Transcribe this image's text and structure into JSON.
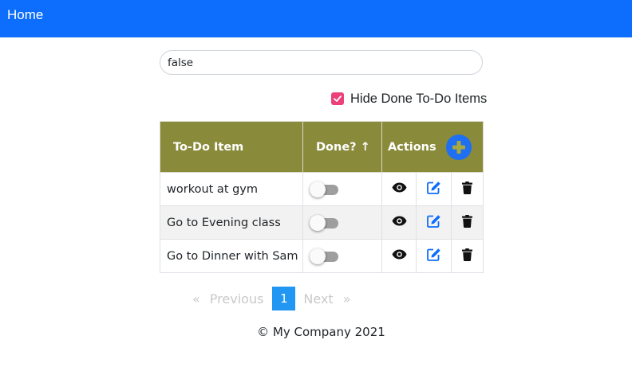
{
  "navbar": {
    "home_label": "Home",
    "color": "#0d6efd"
  },
  "search": {
    "value": "false",
    "placeholder": ""
  },
  "filter": {
    "hide_done_label": "Hide Done To-Do Items",
    "hide_done_checked": true,
    "checkbox_color": "#ec407a"
  },
  "table": {
    "header_color": "#898a3a",
    "columns": {
      "item": "To-Do Item",
      "done": "Done? ↑",
      "actions": "Actions"
    },
    "add_button": {
      "icon": "plus-circle-icon",
      "color": "#1e6ff1",
      "plus_color": "#a7a83f"
    },
    "action_icons": {
      "view": "eye-icon",
      "edit": "edit-icon",
      "delete": "trash-icon",
      "edit_color": "#0d6efd"
    },
    "rows": [
      {
        "item": "workout at gym",
        "done": false
      },
      {
        "item": "Go to Evening class",
        "done": false
      },
      {
        "item": "Go to Dinner with Sam",
        "done": false
      }
    ]
  },
  "pagination": {
    "prev_arrow": "«",
    "prev_label": "Previous",
    "current_page": "1",
    "next_label": "Next",
    "next_arrow": "»",
    "active_color": "#2196f3"
  },
  "footer": {
    "text": "© My Company 2021"
  }
}
